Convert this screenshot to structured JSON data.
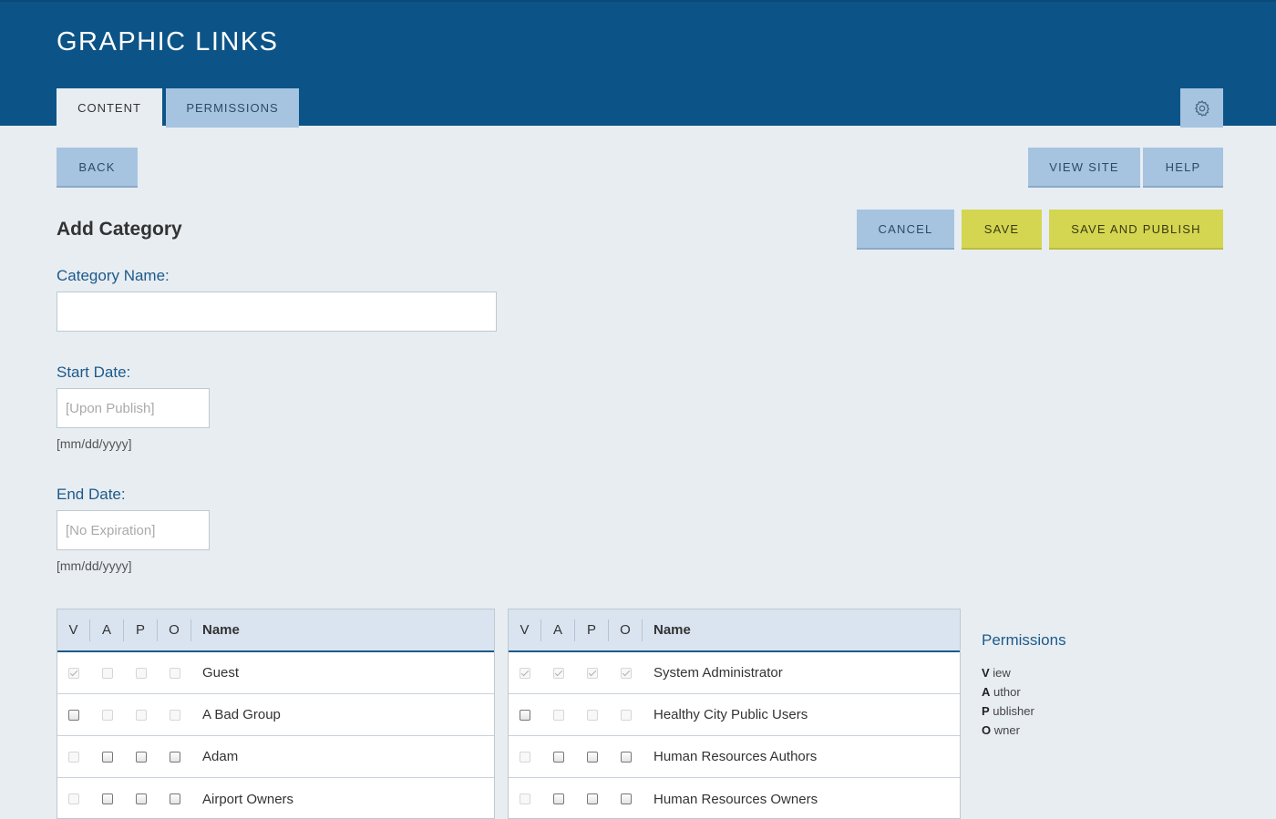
{
  "app": {
    "title": "GRAPHIC LINKS"
  },
  "tabs": [
    {
      "label": "CONTENT",
      "active": true
    },
    {
      "label": "PERMISSIONS",
      "active": false
    }
  ],
  "toolbar": {
    "back": "BACK",
    "view_site": "VIEW SITE",
    "help": "HELP",
    "cancel": "CANCEL",
    "save": "SAVE",
    "save_publish": "SAVE AND PUBLISH"
  },
  "form": {
    "title": "Add Category",
    "category_label": "Category Name:",
    "category_value": "",
    "start_label": "Start Date:",
    "start_placeholder": "[Upon Publish]",
    "start_hint": "[mm/dd/yyyy]",
    "end_label": "End Date:",
    "end_placeholder": "[No Expiration]",
    "end_hint": "[mm/dd/yyyy]"
  },
  "table_headers": {
    "v": "V",
    "a": "A",
    "p": "P",
    "o": "O",
    "name": "Name"
  },
  "left_rows": [
    {
      "name": "Guest",
      "perms": [
        "checked-disabled",
        "disabled",
        "disabled",
        "disabled"
      ]
    },
    {
      "name": "A Bad Group",
      "perms": [
        "enabled",
        "disabled",
        "disabled",
        "disabled"
      ]
    },
    {
      "name": "Adam",
      "perms": [
        "disabled",
        "enabled",
        "enabled",
        "enabled"
      ]
    },
    {
      "name": "Airport Owners",
      "perms": [
        "disabled",
        "enabled",
        "enabled",
        "enabled"
      ]
    }
  ],
  "right_rows": [
    {
      "name": "System Administrator",
      "perms": [
        "checked-disabled",
        "checked-disabled",
        "checked-disabled",
        "checked-disabled"
      ]
    },
    {
      "name": "Healthy City Public Users",
      "perms": [
        "enabled",
        "disabled",
        "disabled",
        "disabled"
      ]
    },
    {
      "name": "Human Resources Authors",
      "perms": [
        "disabled",
        "enabled",
        "enabled",
        "enabled"
      ]
    },
    {
      "name": "Human Resources Owners",
      "perms": [
        "disabled",
        "enabled",
        "enabled",
        "enabled"
      ]
    }
  ],
  "legend": {
    "title": "Permissions",
    "items": [
      {
        "key": "V",
        "rest": "iew"
      },
      {
        "key": "A",
        "rest": "uthor"
      },
      {
        "key": "P",
        "rest": "ublisher"
      },
      {
        "key": "O",
        "rest": "wner"
      }
    ]
  },
  "icons": {
    "settings": "gear-icon"
  }
}
